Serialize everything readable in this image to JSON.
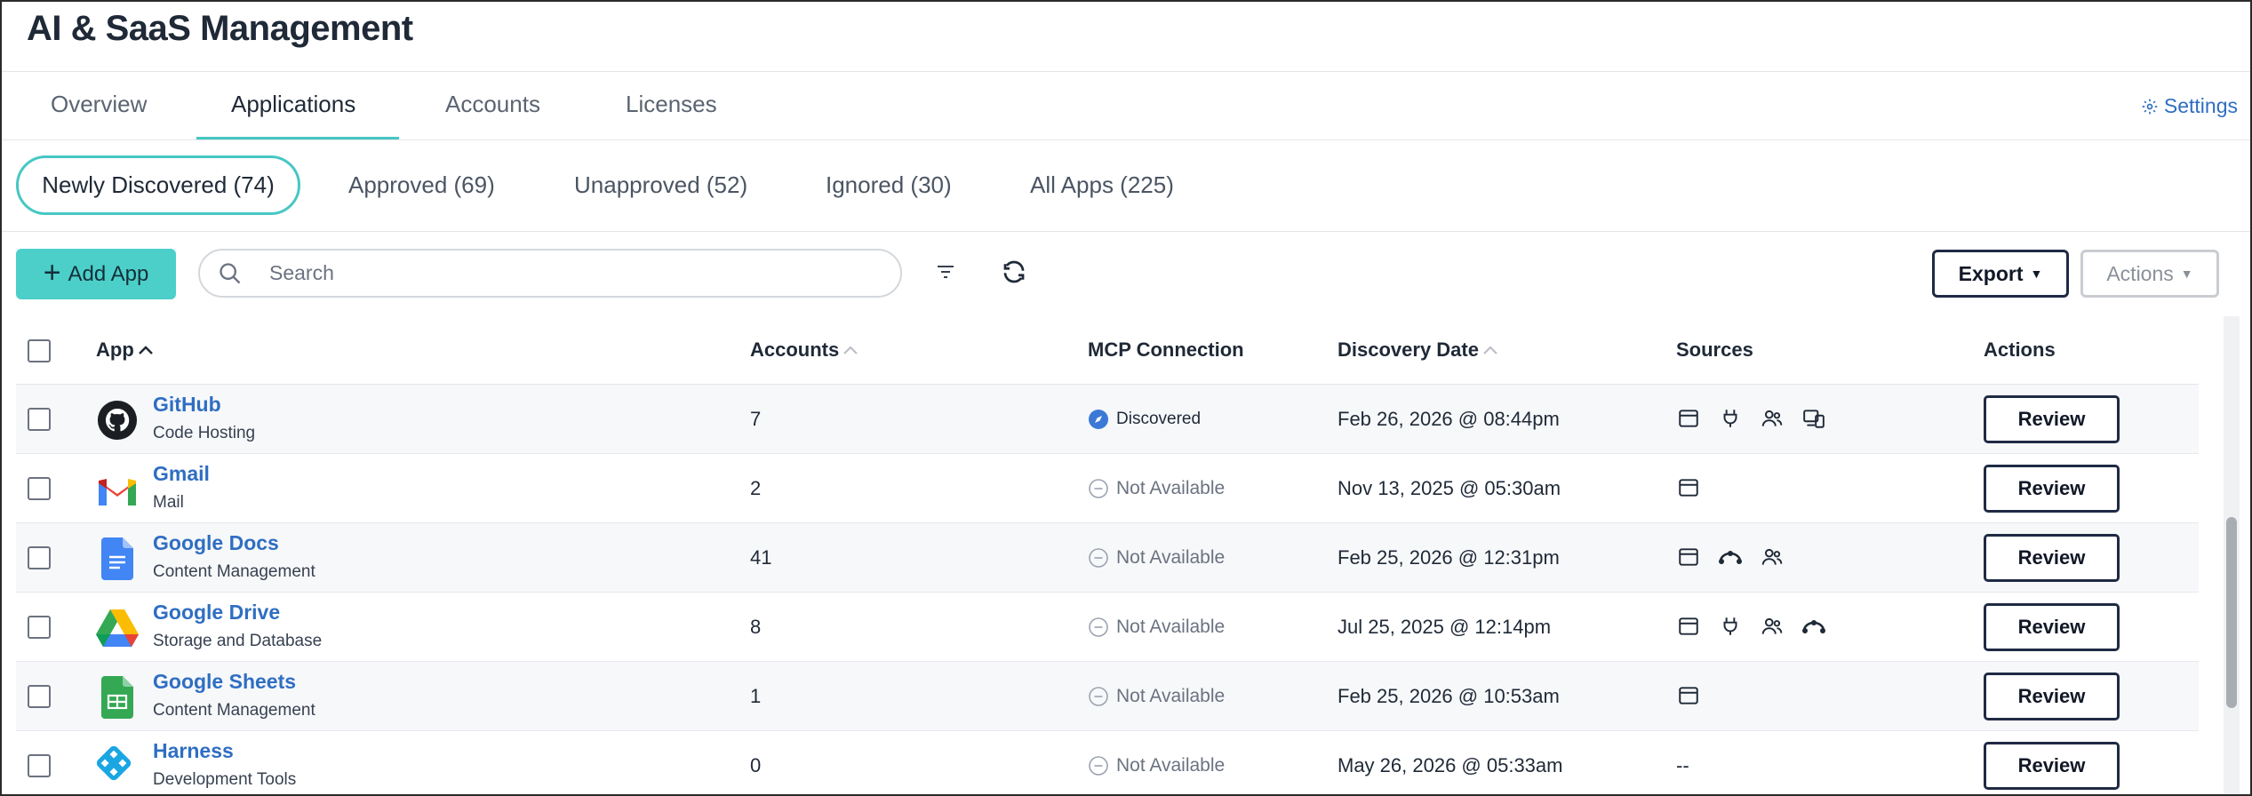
{
  "header": {
    "title": "AI & SaaS Management"
  },
  "main_tabs": [
    {
      "label": "Overview"
    },
    {
      "label": "Applications",
      "active": true
    },
    {
      "label": "Accounts"
    },
    {
      "label": "Licenses"
    }
  ],
  "settings": {
    "label": "Settings",
    "icon": "gear-icon"
  },
  "filter_tabs": [
    {
      "label": "Newly Discovered (74)",
      "active": true
    },
    {
      "label": "Approved (69)"
    },
    {
      "label": "Unapproved (52)"
    },
    {
      "label": "Ignored (30)"
    },
    {
      "label": "All Apps (225)"
    }
  ],
  "toolbar": {
    "add_label": "Add App",
    "search_placeholder": "Search",
    "export_label": "Export",
    "actions_label": "Actions"
  },
  "table": {
    "columns": {
      "app": "App",
      "accounts": "Accounts",
      "mcp": "MCP Connection",
      "discovery": "Discovery Date",
      "sources": "Sources",
      "actions": "Actions"
    },
    "rows": [
      {
        "name": "GitHub",
        "category": "Code Hosting",
        "accounts": "7",
        "mcp": "Discovered",
        "date": "Feb 26, 2026 @ 08:44pm",
        "sources": [
          "browser-icon",
          "plug-icon",
          "users-icon",
          "devices-icon"
        ],
        "action": "Review"
      },
      {
        "name": "Gmail",
        "category": "Mail",
        "accounts": "2",
        "mcp": "Not Available",
        "date": "Nov 13, 2025 @ 05:30am",
        "sources": [
          "browser-icon"
        ],
        "action": "Review"
      },
      {
        "name": "Google Docs",
        "category": "Content Management",
        "accounts": "41",
        "mcp": "Not Available",
        "date": "Feb 25, 2026 @ 12:31pm",
        "sources": [
          "browser-icon",
          "network-icon",
          "users-icon"
        ],
        "action": "Review"
      },
      {
        "name": "Google Drive",
        "category": "Storage and Database",
        "accounts": "8",
        "mcp": "Not Available",
        "date": "Jul 25, 2025 @ 12:14pm",
        "sources": [
          "browser-icon",
          "plug-icon",
          "users-icon",
          "network-icon"
        ],
        "action": "Review"
      },
      {
        "name": "Google Sheets",
        "category": "Content Management",
        "accounts": "1",
        "mcp": "Not Available",
        "date": "Feb 25, 2026 @ 10:53am",
        "sources": [
          "browser-icon"
        ],
        "action": "Review"
      },
      {
        "name": "Harness",
        "category": "Development Tools",
        "accounts": "0",
        "mcp": "Not Available",
        "date": "May 26, 2026 @ 05:33am",
        "sources_text": "--",
        "action": "Review"
      }
    ]
  },
  "colors": {
    "accent": "#47c7c4",
    "link": "#2f6ec2",
    "button_border": "#1f2a44"
  }
}
